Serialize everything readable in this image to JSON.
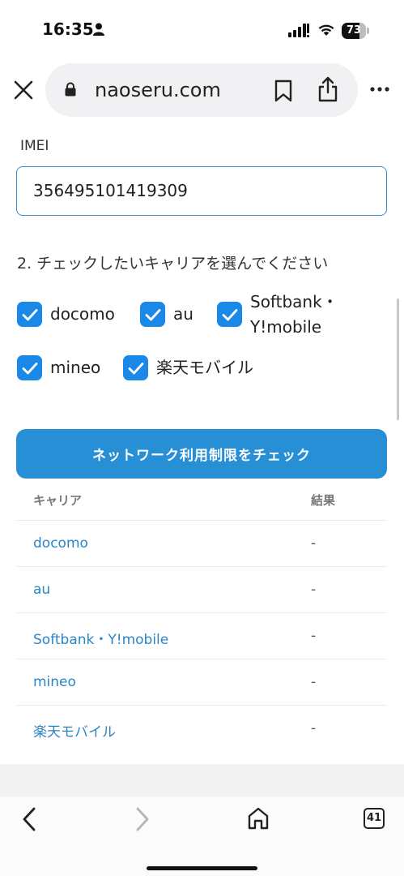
{
  "status_bar": {
    "time": "16:35",
    "battery": "73",
    "battery_level": 0.73
  },
  "browser": {
    "domain": "naoseru.com",
    "tab_count": "41"
  },
  "form": {
    "imei_label": "IMEI",
    "imei_value": "356495101419309",
    "section_title": "2. チェックしたいキャリアを選んでください",
    "carriers": {
      "docomo": {
        "label": "docomo",
        "checked": true
      },
      "au": {
        "label": "au",
        "checked": true
      },
      "softbank": {
        "label_line1": "Softbank・",
        "label_line2": "Y!mobile",
        "checked": true
      },
      "mineo": {
        "label": "mineo",
        "checked": true
      },
      "rakuten": {
        "label": "楽天モバイル",
        "checked": true
      }
    },
    "submit_label": "ネットワーク利用制限をチェック"
  },
  "results": {
    "headers": {
      "carrier": "キャリア",
      "result": "結果"
    },
    "rows": [
      {
        "carrier": "docomo",
        "result": "-"
      },
      {
        "carrier": "au",
        "result": "-"
      },
      {
        "carrier": "Softbank・Y!mobile",
        "result": "-"
      },
      {
        "carrier": "mineo",
        "result": "-"
      },
      {
        "carrier": "楽天モバイル",
        "result": "-"
      }
    ]
  },
  "colors": {
    "accent": "#268fd6",
    "checkbox": "#1a88e6",
    "link": "#2b86c6",
    "input_border": "#3b8fd0"
  },
  "icons": [
    "person-icon",
    "signal-icon",
    "wifi-icon",
    "battery-icon",
    "close-icon",
    "lock-icon",
    "bookmark-icon",
    "share-icon",
    "more-icon",
    "checkmark-icon",
    "back-icon",
    "forward-icon",
    "home-icon",
    "tabs-icon"
  ]
}
